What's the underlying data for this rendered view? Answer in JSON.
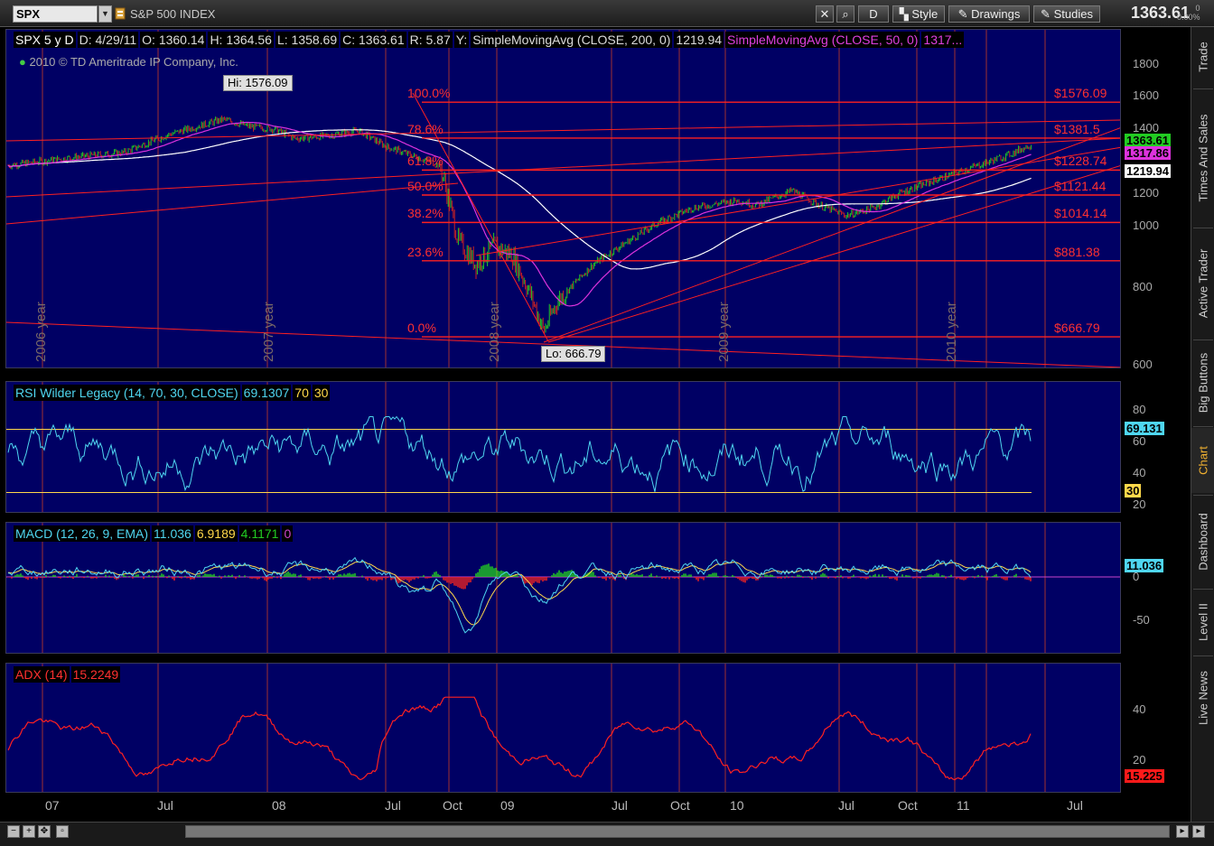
{
  "toolbar": {
    "symbol": "SPX",
    "symbol_name": "S&P 500 INDEX",
    "style_label": "Style",
    "drawings_label": "Drawings",
    "studies_label": "Studies",
    "last_price": "1363.61",
    "change_top": "0",
    "change_pct": "0.00%",
    "period_btn": "D"
  },
  "price_pane": {
    "header": [
      "SPX 5 y D",
      "D: 4/29/11",
      "O: 1360.14",
      "H: 1364.56",
      "L: 1358.69",
      "C: 1363.61",
      "R: 5.87",
      "Y:"
    ],
    "sma200_label": "SimpleMovingAvg (CLOSE, 200, 0)",
    "sma200_value": "1219.94",
    "sma50_label": "SimpleMovingAvg (CLOSE, 50, 0)",
    "sma50_value": "1317...",
    "copyright": "2010 © TD Ameritrade IP Company, Inc.",
    "hi_label": "Hi: 1576.09",
    "lo_label": "Lo: 666.79",
    "y_ticks": [
      "1800",
      "1600",
      "1400",
      "1200",
      "1000",
      "800",
      "600"
    ],
    "tags": {
      "last": "1363.61",
      "sma50": "1317.86",
      "sma200": "1219.94"
    },
    "fib_levels": [
      {
        "pct": "100.0%",
        "price": "$1576.09"
      },
      {
        "pct": "78.6%",
        "price": "$1381.5"
      },
      {
        "pct": "61.8%",
        "price": "$1228.74"
      },
      {
        "pct": "50.0%",
        "price": "$1121.44"
      },
      {
        "pct": "38.2%",
        "price": "$1014.14"
      },
      {
        "pct": "23.6%",
        "price": "$881.38"
      },
      {
        "pct": "0.0%",
        "price": "$666.79"
      }
    ],
    "year_labels": [
      "2006 year",
      "2007 year",
      "2008 year",
      "2009 year",
      "2010 year"
    ]
  },
  "rsi_pane": {
    "label": "RSI Wilder Legacy (14, 70, 30, CLOSE)",
    "value": "69.1307",
    "ob": "70",
    "os": "30",
    "y_ticks": [
      "80",
      "60",
      "40",
      "20"
    ],
    "tag_value": "69.131",
    "tag_os": "30"
  },
  "macd_pane": {
    "label": "MACD (12, 26, 9, EMA)",
    "value": "11.036",
    "avg": "6.9189",
    "diff": "4.1171",
    "zero": "0",
    "y_ticks": [
      "0",
      "-50"
    ],
    "tag_value": "11.036"
  },
  "adx_pane": {
    "label": "ADX (14)",
    "value": "15.2249",
    "y_ticks": [
      "40",
      "20"
    ],
    "tag_value": "15.225"
  },
  "x_axis": [
    "07",
    "Jul",
    "08",
    "Jul",
    "Oct",
    "09",
    "Jul",
    "Oct",
    "10",
    "Jul",
    "Oct",
    "11",
    "Jul"
  ],
  "right_tabs": [
    "Trade",
    "Times And Sales",
    "Active Trader",
    "Big Buttons",
    "Chart",
    "Dashboard",
    "Level II",
    "Live News"
  ],
  "colors": {
    "pane_bg": "#000064",
    "price_up": "#22cc22",
    "price_down": "#cc2222",
    "sma200": "#ffffff",
    "sma50": "#dd33dd",
    "fib": "#ff2020",
    "rsi": "#4fd6f0",
    "macd": "#4fd6f0",
    "macd_avg": "#ffd84a",
    "adx": "#ff2020"
  }
}
